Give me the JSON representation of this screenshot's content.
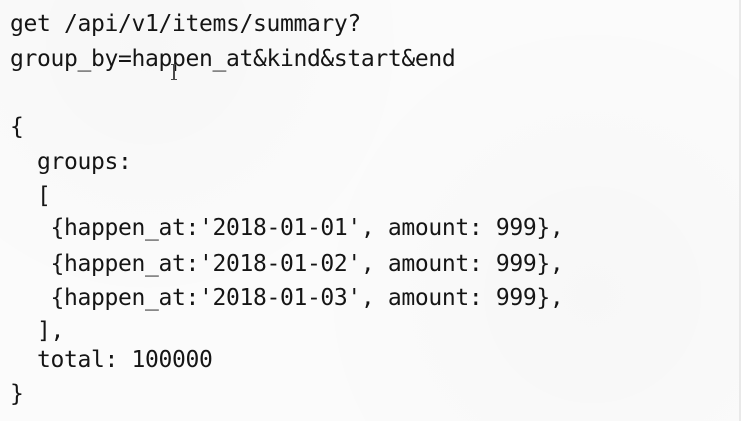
{
  "code": {
    "lines": [
      "get /api/v1/items/summary?",
      "group_by=happen_at&kind&start&end",
      "",
      "{",
      "  groups:",
      "  [",
      "   {happen_at:'2018-01-01', amount: 999},",
      "   {happen_at:'2018-01-02', amount: 999},",
      "   {happen_at:'2018-01-03', amount: 999},",
      "  ],",
      "  total: 100000",
      "}"
    ]
  }
}
